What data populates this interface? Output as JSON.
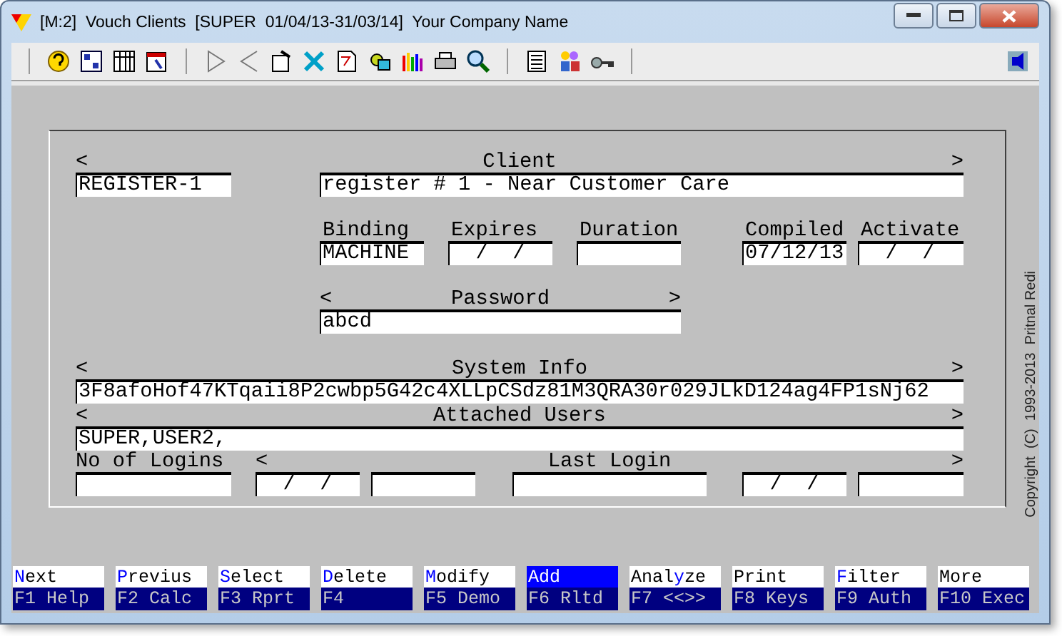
{
  "window": {
    "title": "[M:2]  Vouch Clients  [SUPER  01/04/13-31/03/14]  Your Company Name"
  },
  "form": {
    "client_header": {
      "left": "<",
      "label": "Client",
      "right": ">"
    },
    "code": "REGISTER-1",
    "client": "register # 1 - Near Customer Care",
    "labels": [
      "Binding",
      "Expires",
      "Duration",
      "Compiled",
      "Activate"
    ],
    "binding": "MACHINE",
    "expires": "  /  /",
    "compiled": "07/12/13",
    "activate": "  /  /",
    "password_header": {
      "left": "<",
      "label": "Password",
      "right": ">"
    },
    "password": "abcd",
    "system_header": {
      "left": "<",
      "label": "System Info",
      "right": ">"
    },
    "system_info": "3F8afoHof47KTqaii8P2cwbp5G42c4XLLpCSdz81M3QRA30r029JLkD124ag4FP1sNj62",
    "users_header": {
      "left": "<",
      "label": "Attached Users",
      "right": ">"
    },
    "users": "SUPER,USER2,",
    "logins_label": "No of Logins",
    "last_header": {
      "left": "<",
      "label": "Last Login",
      "right": ">"
    },
    "date_1": "  /  /",
    "date_2": "  /  /"
  },
  "copyright": "Copyright  (C)  1993-2013  Pritnal Redi",
  "function_keys": [
    {
      "hotkey": "N",
      "after": "ext",
      "key": "F1 Help",
      "selected": false
    },
    {
      "hotkey": "P",
      "after": "revius",
      "key": "F2 Calc",
      "selected": false
    },
    {
      "hotkey": "S",
      "after": "elect",
      "key": "F3 Rprt",
      "selected": false
    },
    {
      "hotkey": "D",
      "after": "elete",
      "key": "F4",
      "selected": false
    },
    {
      "hotkey": "M",
      "after": "odify",
      "key": "F5 Demo",
      "selected": false
    },
    {
      "after": "Add",
      "key": "F6 Rltd",
      "selected": true
    },
    {
      "before": "Anal",
      "hotkey": "y",
      "after": "ze",
      "key": "F7 <<>>",
      "selected": false
    },
    {
      "after": "Print",
      "key": "F8 Keys",
      "selected": false
    },
    {
      "hotkey": "F",
      "after": "ilter",
      "key": "F9 Auth",
      "selected": false
    },
    {
      "after": "More",
      "key": "F10 Exec",
      "selected": false
    }
  ]
}
